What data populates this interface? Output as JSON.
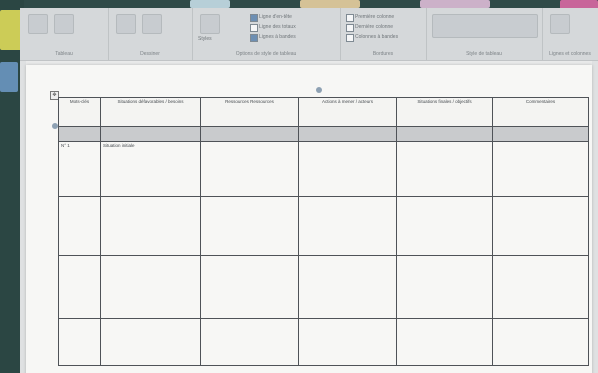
{
  "colors": {
    "ribbon": "#d5d8da",
    "page": "#f7f7f5",
    "grid_line": "#4f5358",
    "selected_row": "#c9cbcd"
  },
  "ribbon": {
    "groups": [
      {
        "name": "Tableau"
      },
      {
        "name": "Dessiner"
      },
      {
        "name": "Options de style de tableau"
      },
      {
        "name": "Bordures"
      },
      {
        "name": "Style de tableau"
      },
      {
        "name": "Lignes et colonnes"
      }
    ],
    "buttons": {
      "ligne_en_tete": "Ligne d'en-tête",
      "ligne_totaux": "Ligne des totaux",
      "lignes_a_bandes": "Lignes à bandes",
      "premiere_colonne": "Première colonne",
      "derniere_colonne": "Dernière colonne",
      "colonnes_a_bandes": "Colonnes à bandes",
      "styles": "Styles"
    }
  },
  "table": {
    "headers": [
      "Mots-clés",
      "Situations défavorables / besoins",
      "Ressources Ressources",
      "Actions à mener / acteurs",
      "Situations finales / objectifs",
      "Commentaires"
    ],
    "first_row": [
      "N° 1",
      "Situation initiale",
      "",
      "",
      "",
      ""
    ]
  }
}
